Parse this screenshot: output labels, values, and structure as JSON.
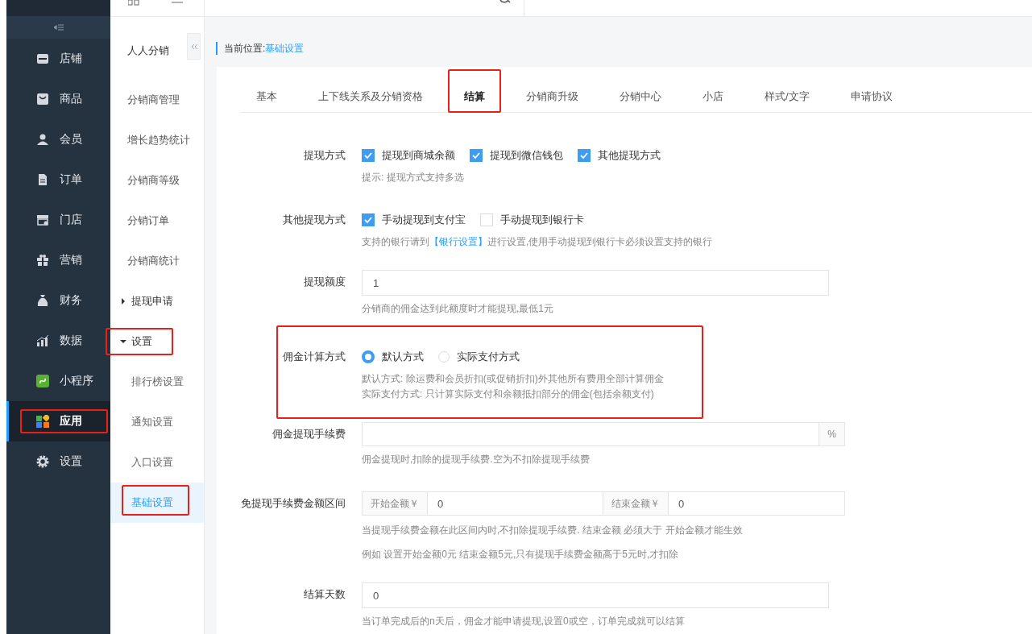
{
  "sidebar": {
    "items": [
      {
        "label": "店铺",
        "selected": false,
        "highlighted": false
      },
      {
        "label": "商品",
        "selected": false,
        "highlighted": false
      },
      {
        "label": "会员",
        "selected": false,
        "highlighted": false
      },
      {
        "label": "订单",
        "selected": false,
        "highlighted": false
      },
      {
        "label": "门店",
        "selected": false,
        "highlighted": false
      },
      {
        "label": "营销",
        "selected": false,
        "highlighted": false
      },
      {
        "label": "财务",
        "selected": false,
        "highlighted": false
      },
      {
        "label": "数据",
        "selected": false,
        "highlighted": false
      },
      {
        "label": "小程序",
        "selected": false,
        "highlighted": false
      },
      {
        "label": "应用",
        "selected": true,
        "highlighted": true
      },
      {
        "label": "设置",
        "selected": false,
        "highlighted": false
      }
    ]
  },
  "submenu": {
    "title": "人人分销",
    "items": [
      {
        "kind": "link",
        "label": "分销商管理",
        "selected": false,
        "highlighted": false
      },
      {
        "kind": "link",
        "label": "增长趋势统计",
        "selected": false,
        "highlighted": false
      },
      {
        "kind": "link",
        "label": "分销商等级",
        "selected": false,
        "highlighted": false
      },
      {
        "kind": "link",
        "label": "分销订单",
        "selected": false,
        "highlighted": false
      },
      {
        "kind": "link",
        "label": "分销商统计",
        "selected": false,
        "highlighted": false
      },
      {
        "kind": "group",
        "label": "提现申请",
        "expanded": false,
        "highlighted": false
      },
      {
        "kind": "group",
        "label": "设置",
        "expanded": true,
        "highlighted": true,
        "children": [
          {
            "label": "排行榜设置",
            "selected": false,
            "highlighted": false
          },
          {
            "label": "通知设置",
            "selected": false,
            "highlighted": false
          },
          {
            "label": "入口设置",
            "selected": false,
            "highlighted": false
          },
          {
            "label": "基础设置",
            "selected": true,
            "highlighted": true
          }
        ]
      }
    ]
  },
  "breadcrumb": {
    "label": "当前位置:",
    "current": "基础设置"
  },
  "tabs": [
    {
      "label": "基本",
      "selected": false,
      "highlighted": false
    },
    {
      "label": "上下线关系及分销资格",
      "selected": false,
      "highlighted": false
    },
    {
      "label": "结算",
      "selected": true,
      "highlighted": true
    },
    {
      "label": "分销商升级",
      "selected": false,
      "highlighted": false
    },
    {
      "label": "分销中心",
      "selected": false,
      "highlighted": false
    },
    {
      "label": "小店",
      "selected": false,
      "highlighted": false
    },
    {
      "label": "样式/文字",
      "selected": false,
      "highlighted": false
    },
    {
      "label": "申请协议",
      "selected": false,
      "highlighted": false
    }
  ],
  "form": [
    {
      "kind": "checkbox",
      "label": "提现方式",
      "highlighted": false,
      "options": [
        {
          "label": "提现到商城余额",
          "checked": true
        },
        {
          "label": "提现到微信钱包",
          "checked": true
        },
        {
          "label": "其他提现方式",
          "checked": true
        }
      ],
      "hints": [
        [
          {
            "kind": "text",
            "text": "提示: 提现方式支持多选"
          }
        ]
      ]
    },
    {
      "kind": "checkbox",
      "label": "其他提现方式",
      "highlighted": false,
      "options": [
        {
          "label": "手动提现到支付宝",
          "checked": true
        },
        {
          "label": "手动提现到银行卡",
          "checked": false
        }
      ],
      "hints": [
        [
          {
            "kind": "text",
            "text": "支持的银行请到"
          },
          {
            "kind": "link",
            "text": "【银行设置】"
          },
          {
            "kind": "text",
            "text": "进行设置,使用手动提现到银行卡必须设置支持的银行"
          }
        ]
      ]
    },
    {
      "kind": "input",
      "label": "提现额度",
      "highlighted": false,
      "value": "1",
      "hints": [
        [
          {
            "kind": "text",
            "text": "分销商的佣金达到此额度时才能提现,最低1元"
          }
        ]
      ]
    },
    {
      "kind": "radio",
      "label": "佣金计算方式",
      "highlighted": true,
      "options": [
        {
          "label": "默认方式",
          "selected": true
        },
        {
          "label": "实际支付方式",
          "selected": false
        }
      ],
      "hints": [
        [
          {
            "kind": "text",
            "text": "默认方式: 除运费和会员折扣(或促销折扣)外其他所有费用全部计算佣金"
          }
        ],
        [
          {
            "kind": "text",
            "text": "实际支付方式: 只计算实际支付和余额抵扣部分的佣金(包括余额支付)"
          }
        ]
      ]
    },
    {
      "kind": "suffix",
      "label": "佣金提现手续费",
      "highlighted": false,
      "suffix": "%",
      "hints": [
        [
          {
            "kind": "text",
            "text": "佣金提现时,扣除的提现手续费.空为不扣除提现手续费"
          }
        ]
      ]
    },
    {
      "kind": "range",
      "label": "免提现手续费金额区间",
      "highlighted": false,
      "start_label": "开始金额￥",
      "start": "0",
      "end_label": "结束金额￥",
      "end": "0",
      "hints": [
        [
          {
            "kind": "text",
            "text": "当提现手续费金额在此区间内时,不扣除提现手续费. 结束金额 必须大于 开始金额才能生效"
          }
        ],
        [
          {
            "kind": "text",
            "text": "例如 设置开始金额0元 结束金额5元,只有提现手续费金额高于5元时,才扣除"
          }
        ]
      ]
    },
    {
      "kind": "input",
      "label": "结算天数",
      "highlighted": false,
      "value": "0",
      "hints": [
        [
          {
            "kind": "text",
            "text": "当订单完成后的n天后，佣金才能申请提现,设置0或空，订单完成就可以结算"
          }
        ]
      ]
    }
  ]
}
